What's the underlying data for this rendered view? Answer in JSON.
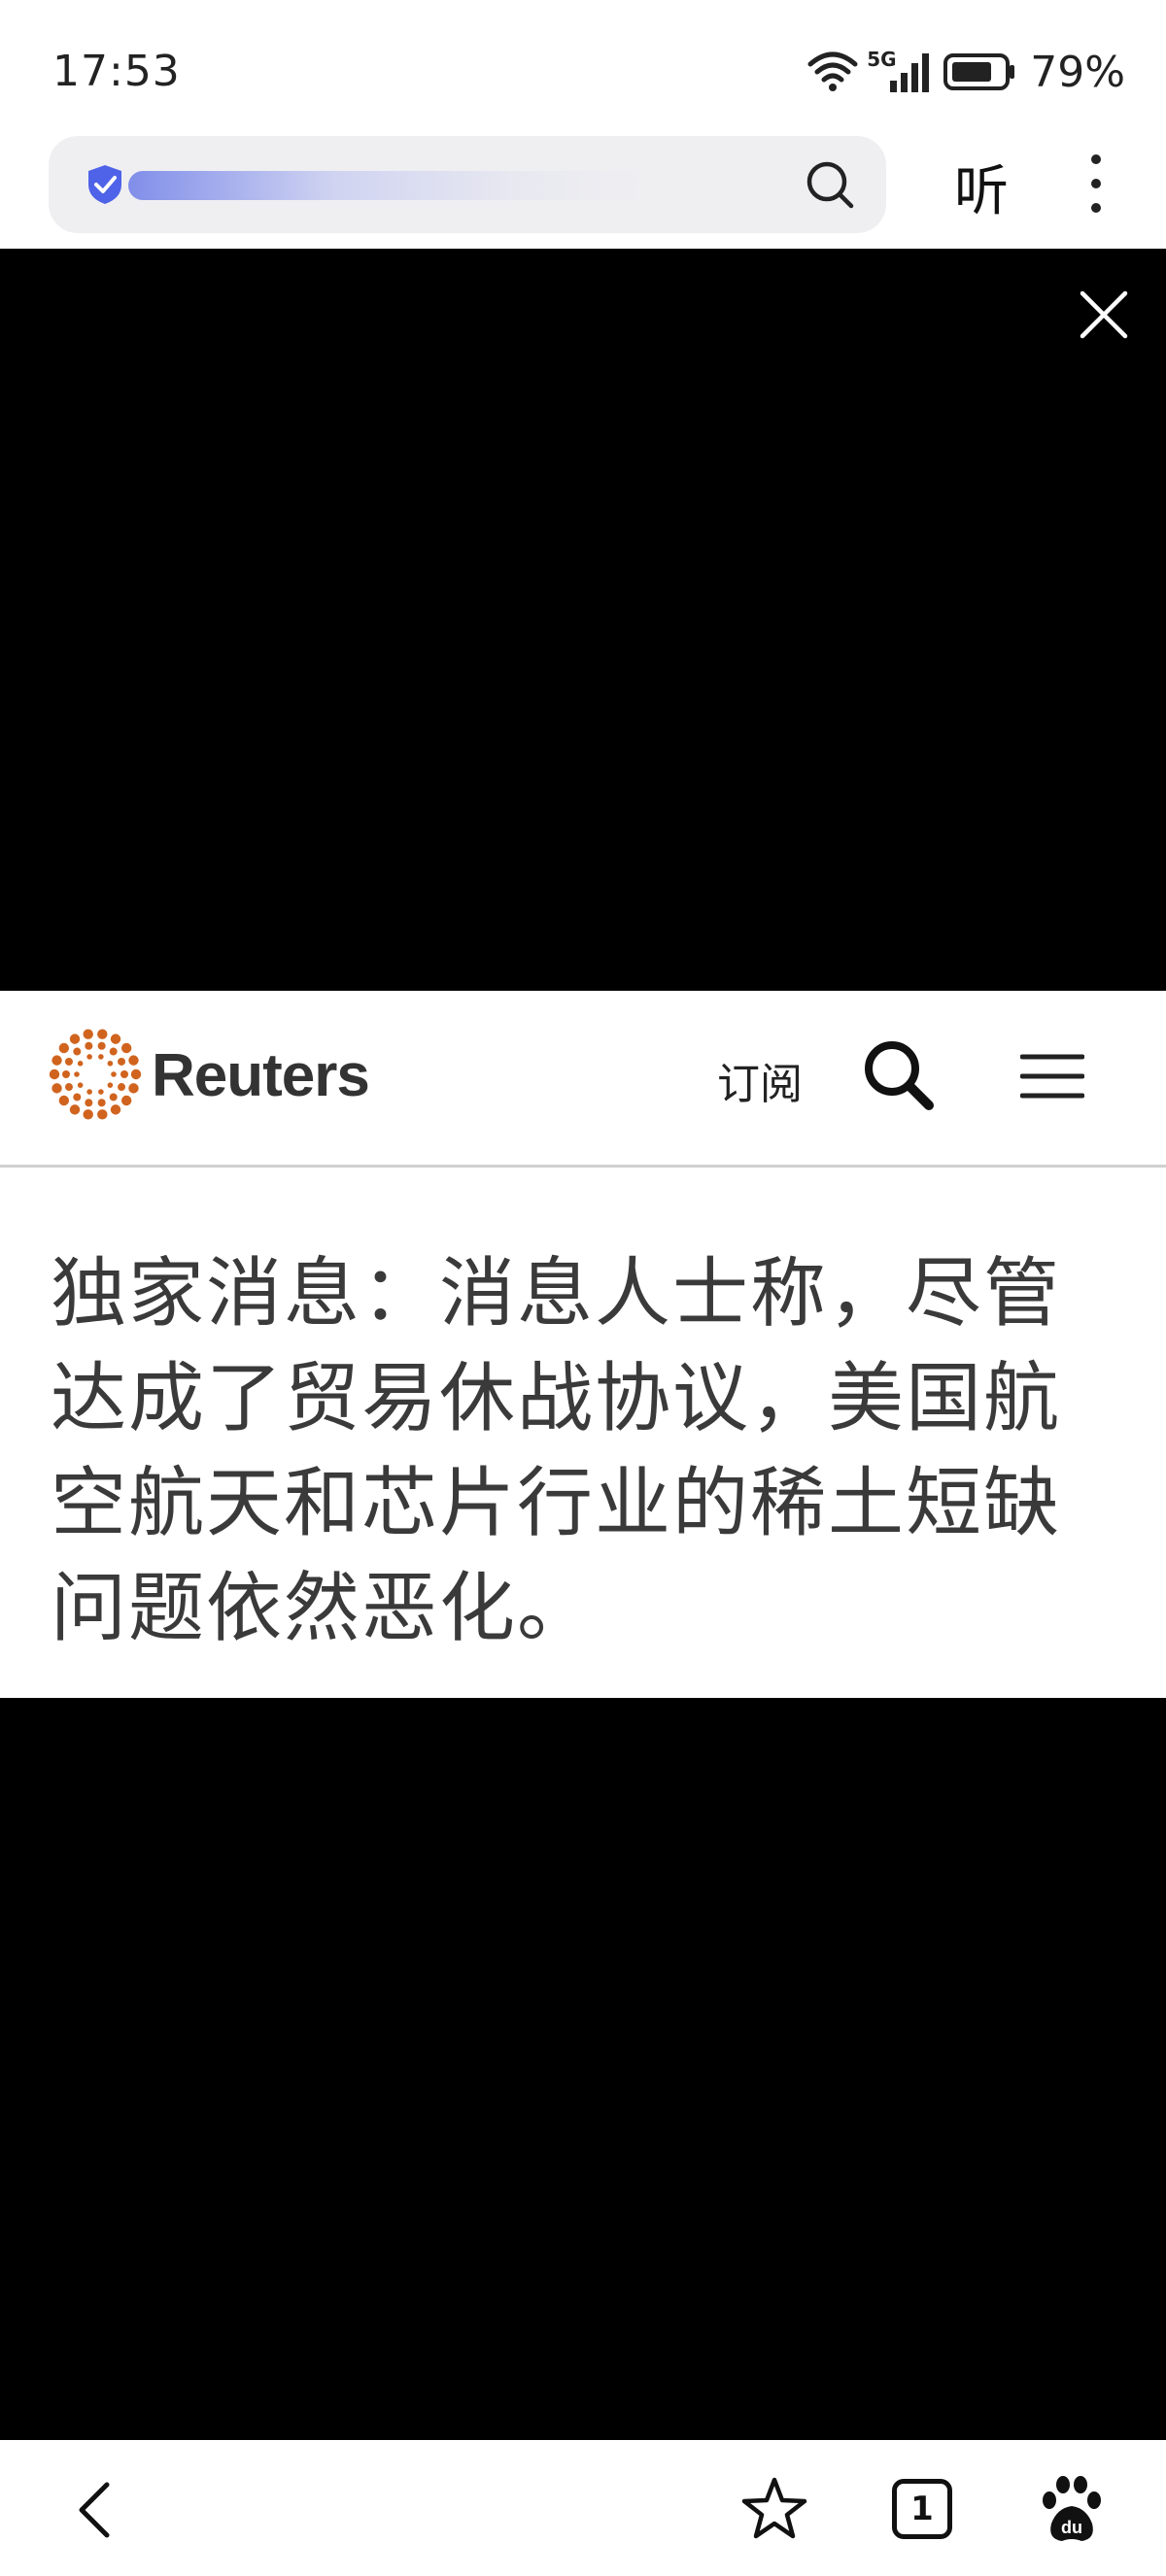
{
  "status_bar": {
    "time": "17:53",
    "network": "5G",
    "battery": "79%",
    "icons": [
      "wifi-icon",
      "signal-icon",
      "battery-icon"
    ]
  },
  "browser": {
    "url_icon": "shield-check-icon",
    "search_icon": "search-icon",
    "listen_label": "听",
    "more_icon": "more-vertical-icon"
  },
  "ad": {
    "close_icon": "close-icon"
  },
  "reuters": {
    "brand": "Reuters",
    "brand_color": "#d0641e",
    "subscribe_label": "订阅",
    "search_icon": "search-icon",
    "menu_icon": "hamburger-menu-icon"
  },
  "article": {
    "headline": "独家消息：消息人士称，尽管达成了贸易休战协议，美国航空航天和芯片行业的稀土短缺问题依然恶化。"
  },
  "bottom_nav": {
    "back_icon": "back-arrow-icon",
    "favorite_icon": "star-icon",
    "tab_count": "1",
    "baidu_icon": "baidu-paw-icon"
  }
}
